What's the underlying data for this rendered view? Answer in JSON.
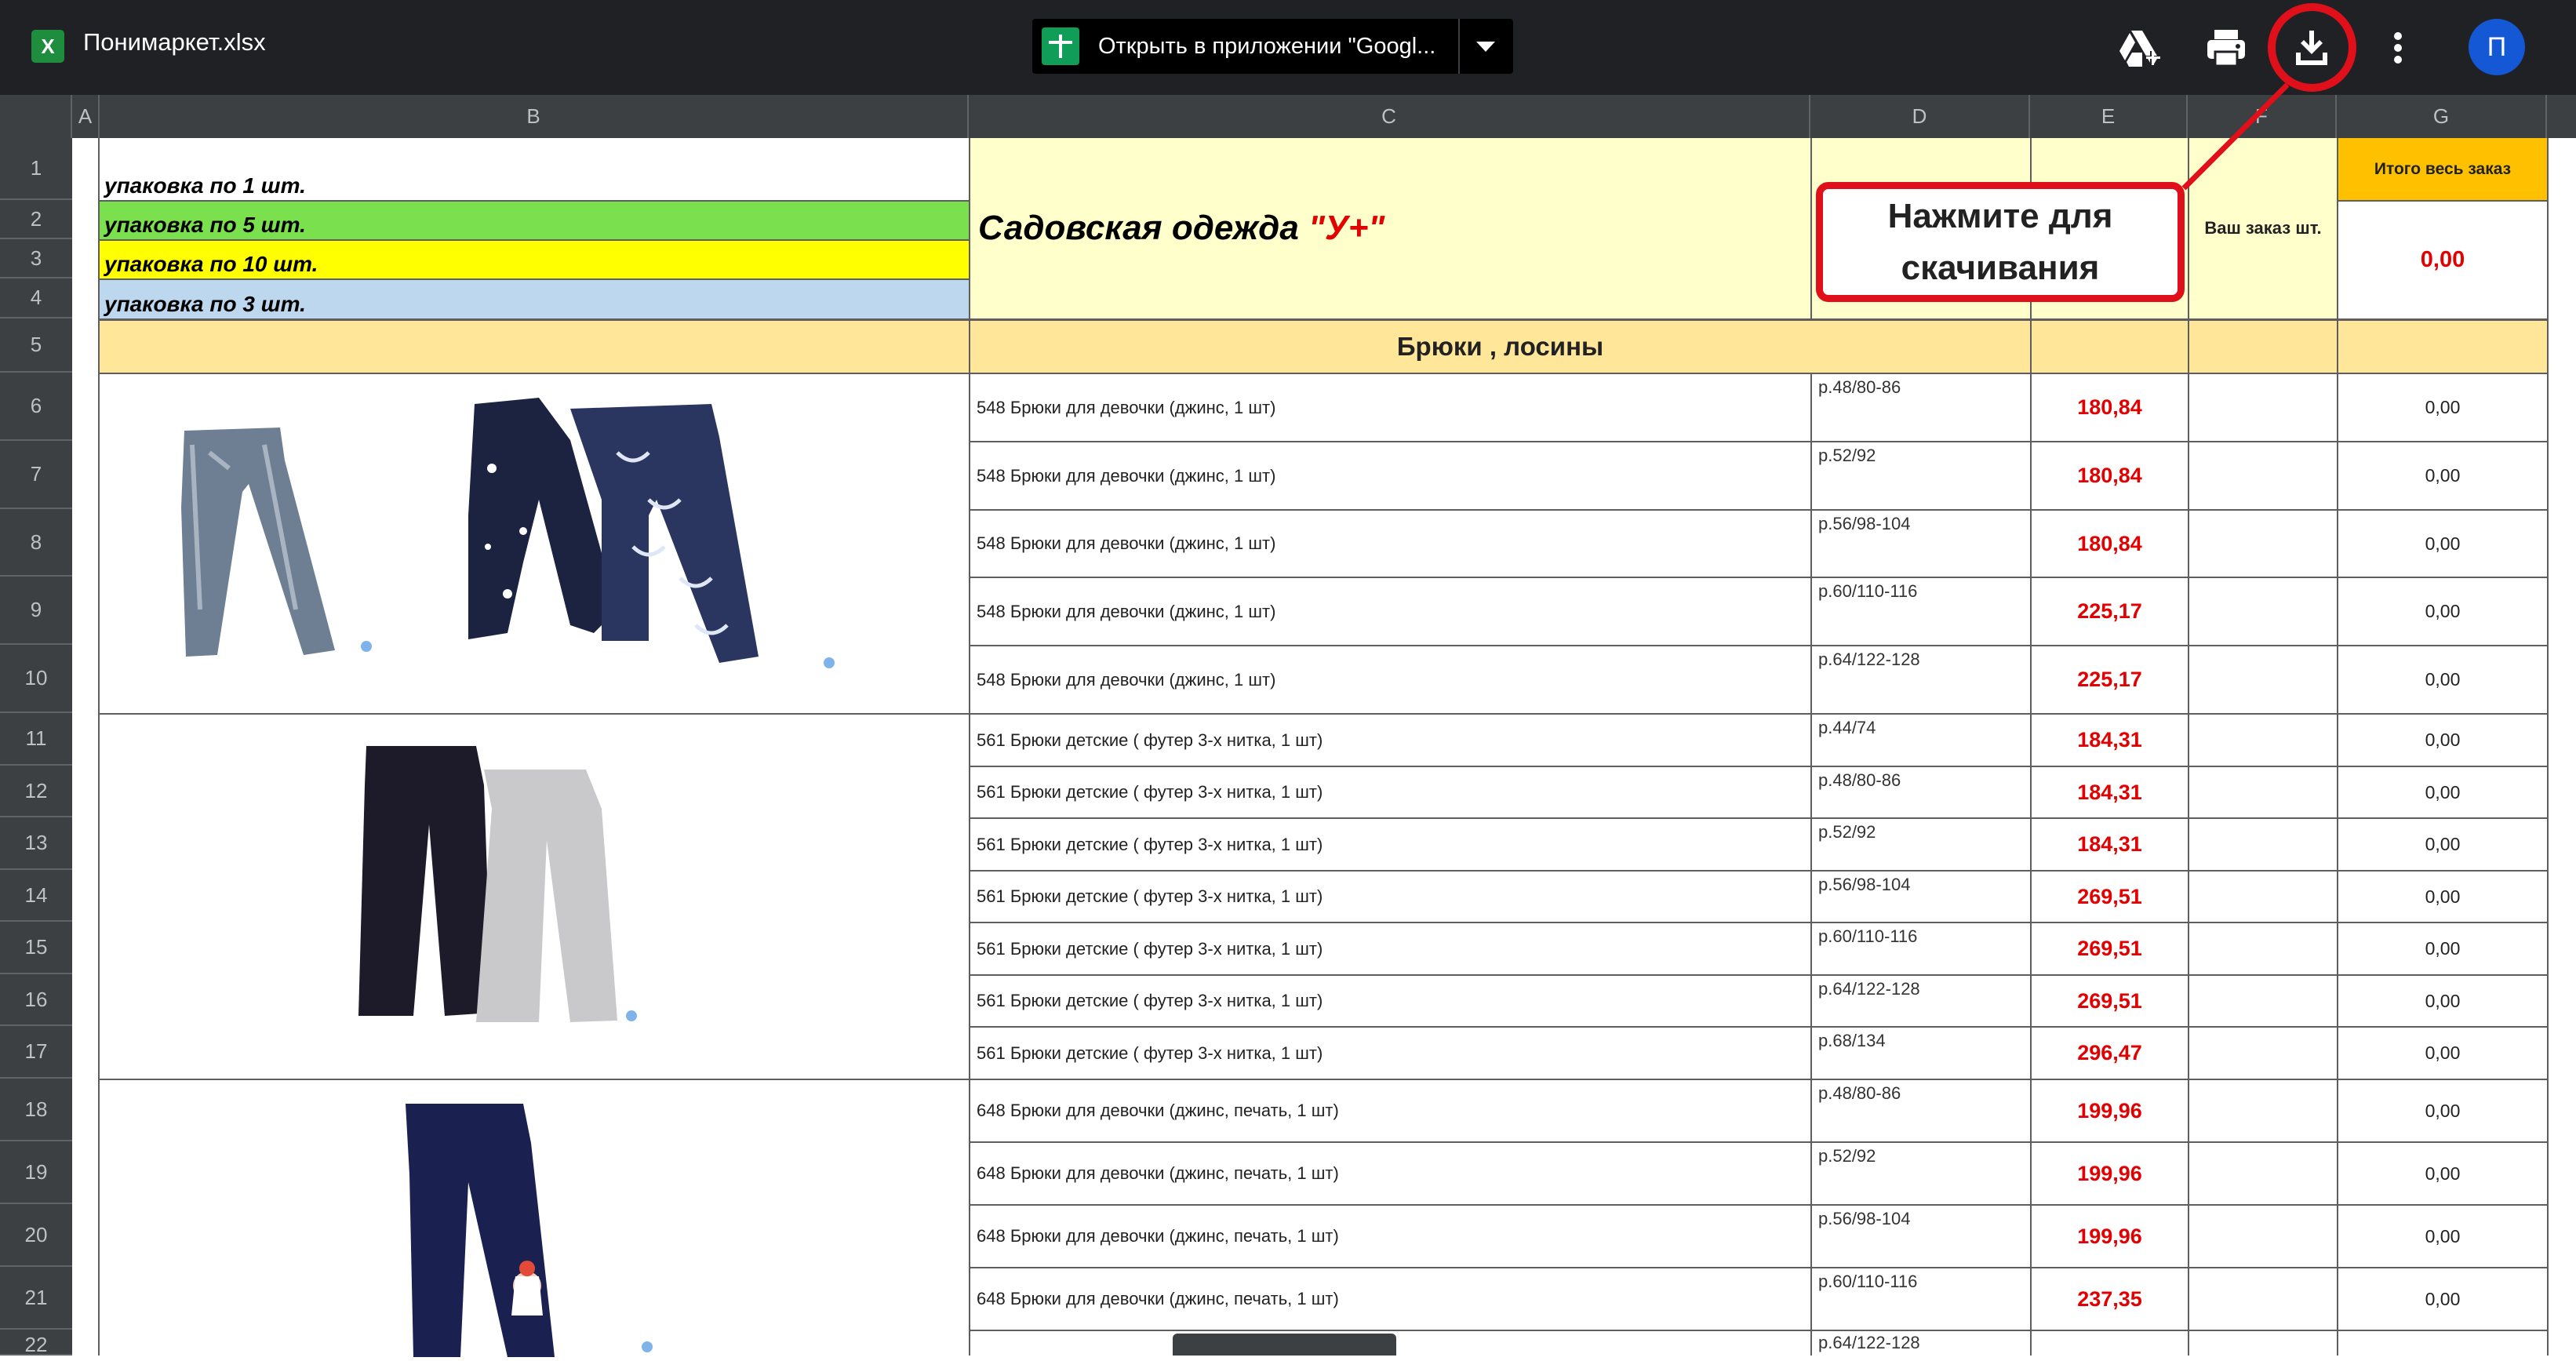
{
  "app": {
    "file_name": "Понимаркет.xlsx",
    "file_icon_letter": "X",
    "open_in_app": "Открыть в приложении \"Googl...",
    "avatar_letter": "П"
  },
  "toolbar_icons": [
    "add-to-drive-icon",
    "print-icon",
    "download-icon",
    "more-vert-icon"
  ],
  "columns": [
    "A",
    "B",
    "C",
    "D",
    "E",
    "F",
    "G"
  ],
  "rows": [
    "1",
    "2",
    "3",
    "4",
    "5",
    "6",
    "7",
    "8",
    "9",
    "10",
    "11",
    "12",
    "13",
    "14",
    "15",
    "16",
    "17",
    "18",
    "19",
    "20",
    "21",
    "22"
  ],
  "legend": [
    {
      "label": "упаковка по 1 шт.",
      "color": "#ffffff"
    },
    {
      "label": "упаковка по 5 шт.",
      "color": "#7be04e"
    },
    {
      "label": "упаковка по 10 шт.",
      "color": "#ffff00"
    },
    {
      "label": "упаковка по 3 шт.",
      "color": "#bdd7ee"
    }
  ],
  "header": {
    "title_main": "Садовская одежда ",
    "title_brand": "\"У+\"",
    "your_order": "Ваш заказ шт.",
    "grand_total_label": "Итого весь заказ",
    "grand_total_value": "0,00"
  },
  "section_title": "Брюки , лосины",
  "products": [
    {
      "name": "548 Брюки для девочки (джинс, 1 шт)",
      "size": "р.48/80-86",
      "price": "180,84",
      "total": "0,00"
    },
    {
      "name": "548 Брюки для девочки (джинс, 1 шт)",
      "size": "р.52/92",
      "price": "180,84",
      "total": "0,00"
    },
    {
      "name": "548 Брюки для девочки (джинс, 1 шт)",
      "size": "р.56/98-104",
      "price": "180,84",
      "total": "0,00"
    },
    {
      "name": "548 Брюки для девочки (джинс, 1 шт)",
      "size": "р.60/110-116",
      "price": "225,17",
      "total": "0,00"
    },
    {
      "name": "548 Брюки для девочки (джинс, 1 шт)",
      "size": "р.64/122-128",
      "price": "225,17",
      "total": "0,00"
    },
    {
      "name": "561 Брюки детские ( футер 3-х нитка, 1 шт)",
      "size": "р.44/74",
      "price": "184,31",
      "total": "0,00"
    },
    {
      "name": "561 Брюки детские ( футер 3-х нитка, 1 шт)",
      "size": "р.48/80-86",
      "price": "184,31",
      "total": "0,00"
    },
    {
      "name": "561 Брюки детские ( футер 3-х нитка, 1 шт)",
      "size": "р.52/92",
      "price": "184,31",
      "total": "0,00"
    },
    {
      "name": "561 Брюки детские ( футер 3-х нитка, 1 шт)",
      "size": "р.56/98-104",
      "price": "269,51",
      "total": "0,00"
    },
    {
      "name": "561 Брюки детские ( футер 3-х нитка, 1 шт)",
      "size": "р.60/110-116",
      "price": "269,51",
      "total": "0,00"
    },
    {
      "name": "561 Брюки детские ( футер 3-х нитка, 1 шт)",
      "size": "р.64/122-128",
      "price": "269,51",
      "total": "0,00"
    },
    {
      "name": "561 Брюки детские ( футер 3-х нитка, 1 шт)",
      "size": "р.68/134",
      "price": "296,47",
      "total": "0,00"
    },
    {
      "name": "648 Брюки для девочки (джинс, печать, 1 шт)",
      "size": "р.48/80-86",
      "price": "199,96",
      "total": "0,00"
    },
    {
      "name": "648 Брюки для девочки (джинс, печать, 1 шт)",
      "size": "р.52/92",
      "price": "199,96",
      "total": "0,00"
    },
    {
      "name": "648 Брюки для девочки (джинс, печать, 1 шт)",
      "size": "р.56/98-104",
      "price": "199,96",
      "total": "0,00"
    },
    {
      "name": "648 Брюки для девочки (джинс, печать, 1 шт)",
      "size": "р.60/110-116",
      "price": "237,35",
      "total": "0,00"
    },
    {
      "name": "",
      "size": "р.64/122-128",
      "price": "",
      "total": ""
    }
  ],
  "tooltip": {
    "text": "Нажмите для скачивания"
  }
}
